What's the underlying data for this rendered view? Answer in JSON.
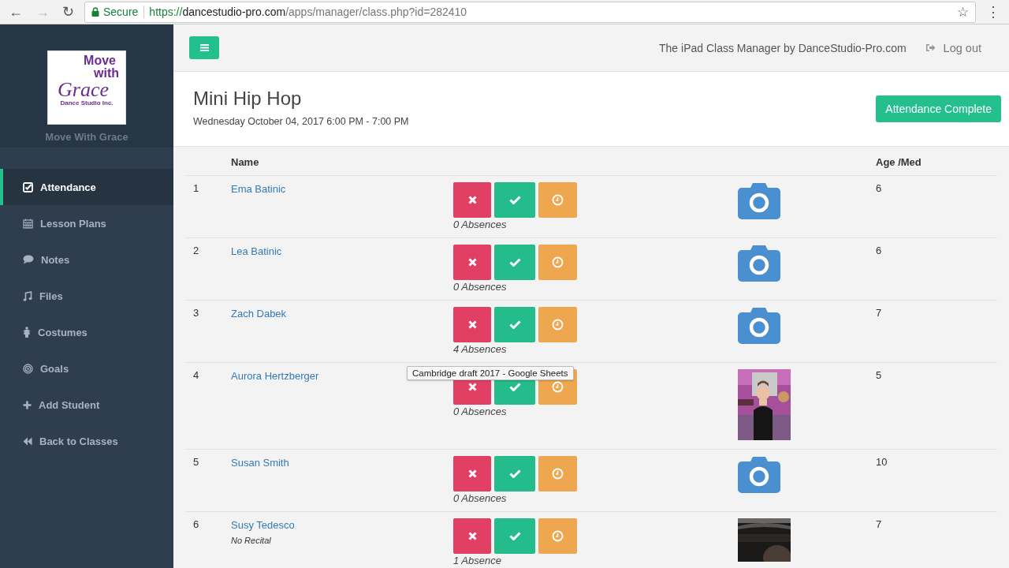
{
  "browser": {
    "back": "←",
    "forward": "→",
    "reload": "↻",
    "secure_label": "Secure",
    "url": {
      "scheme": "https://",
      "host": "dancestudio-pro.com",
      "path": "/apps/manager/class.php?id=282410"
    },
    "star": "☆",
    "menu": "⋮"
  },
  "sidebar": {
    "logo": {
      "line_1": "Move",
      "line_2": "with",
      "line_3": "Grace",
      "line_4": "Dance Studio Inc."
    },
    "studio_name": "Move With Grace",
    "items": [
      {
        "label": "Attendance",
        "selected": true
      },
      {
        "label": "Lesson Plans",
        "selected": false
      },
      {
        "label": "Notes",
        "selected": false
      },
      {
        "label": "Files",
        "selected": false
      },
      {
        "label": "Costumes",
        "selected": false
      },
      {
        "label": "Goals",
        "selected": false
      },
      {
        "label": "Add Student",
        "selected": false
      },
      {
        "label": "Back to Classes",
        "selected": false
      }
    ]
  },
  "topbar": {
    "tagline": "The iPad Class Manager by DanceStudio-Pro.com",
    "logout": "Log out"
  },
  "class": {
    "title": "Mini Hip Hop",
    "schedule": "Wednesday October 04, 2017 6:00 PM - 7:00 PM",
    "complete_button": "Attendance Complete"
  },
  "table": {
    "columns": [
      "Name",
      "Age /Med"
    ],
    "rows": [
      {
        "number": "1",
        "name": "Ema Batinic",
        "absences": "0 Absences",
        "kind": "camera",
        "age": "6"
      },
      {
        "number": "2",
        "name": "Lea Batinic",
        "absences": "0 Absences",
        "kind": "camera",
        "age": "6"
      },
      {
        "number": "3",
        "name": "Zach Dabek",
        "absences": "4 Absences",
        "kind": "camera",
        "age": "7"
      },
      {
        "number": "4",
        "name": "Aurora Hertzberger",
        "absences": "0 Absences",
        "kind": "picture",
        "age": "5"
      },
      {
        "number": "5",
        "name": "Susan Smith",
        "absences": "0 Absences",
        "kind": "camera",
        "age": "10"
      },
      {
        "number": "6",
        "name": "Susy Tedesco",
        "note": "No Recital",
        "absences": "1 Absence",
        "kind": "picture",
        "age": "7"
      }
    ]
  },
  "tooltip": "Cambridge draft 2017 - Google Sheets"
}
